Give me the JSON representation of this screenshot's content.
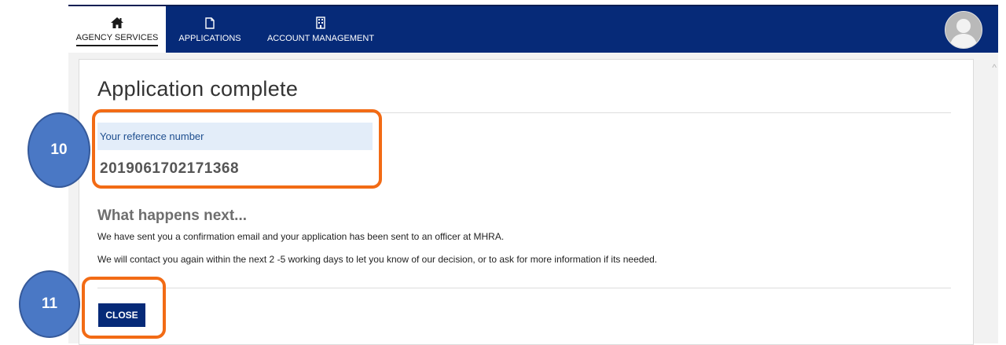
{
  "nav": {
    "tabs": [
      {
        "label": "AGENCY SERVICES",
        "icon": "home-icon",
        "active": true
      },
      {
        "label": "APPLICATIONS",
        "icon": "document-icon",
        "active": false
      },
      {
        "label": "ACCOUNT MANAGEMENT",
        "icon": "building-icon",
        "active": false
      }
    ],
    "avatar_icon": "user-avatar-icon"
  },
  "main": {
    "title": "Application complete",
    "reference": {
      "label": "Your reference number",
      "number": "2019061702171368"
    },
    "next": {
      "heading": "What happens next...",
      "paragraphs": [
        "We have sent you a confirmation email and your application has been sent to an officer at MHRA.",
        "We will contact you again within the next 2 -5 working days to let you know of our decision, or to ask for more information if its needed."
      ]
    },
    "close_label": "CLOSE"
  },
  "annotations": {
    "step_10": "10",
    "step_11": "11"
  },
  "colors": {
    "nav_background": "#062a78",
    "highlight_border": "#f26b15",
    "step_badge": "#4a78c5",
    "reference_header_bg": "#e3edf9"
  }
}
